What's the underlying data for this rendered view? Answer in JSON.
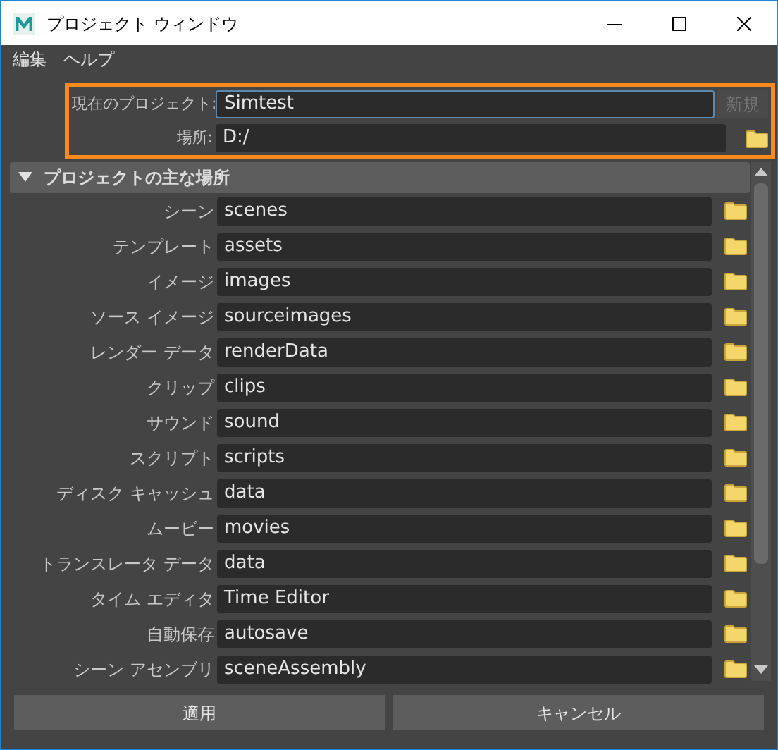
{
  "window": {
    "title": "プロジェクト ウィンドウ"
  },
  "menu": [
    {
      "label": "編集"
    },
    {
      "label": "ヘルプ"
    }
  ],
  "project": {
    "label": "現在のプロジェクト:",
    "value": "Simtest",
    "new_button": {
      "label": "新規",
      "disabled": true
    },
    "location_label": "場所:",
    "location": "D:/"
  },
  "section": {
    "title": "プロジェクトの主な場所",
    "expanded": true
  },
  "locations": [
    {
      "label": "シーン",
      "value": "scenes"
    },
    {
      "label": "テンプレート",
      "value": "assets"
    },
    {
      "label": "イメージ",
      "value": "images"
    },
    {
      "label": "ソース イメージ",
      "value": "sourceimages"
    },
    {
      "label": "レンダー データ",
      "value": "renderData"
    },
    {
      "label": "クリップ",
      "value": "clips"
    },
    {
      "label": "サウンド",
      "value": "sound"
    },
    {
      "label": "スクリプト",
      "value": "scripts"
    },
    {
      "label": "ディスク キャッシュ",
      "value": "data"
    },
    {
      "label": "ムービー",
      "value": "movies"
    },
    {
      "label": "トランスレータ データ",
      "value": "data"
    },
    {
      "label": "タイム エディタ",
      "value": "Time Editor"
    },
    {
      "label": "自動保存",
      "value": "autosave"
    },
    {
      "label": "シーン アセンブリ",
      "value": "sceneAssembly"
    }
  ],
  "buttons": [
    {
      "label": "適用"
    },
    {
      "label": "キャンセル"
    }
  ]
}
